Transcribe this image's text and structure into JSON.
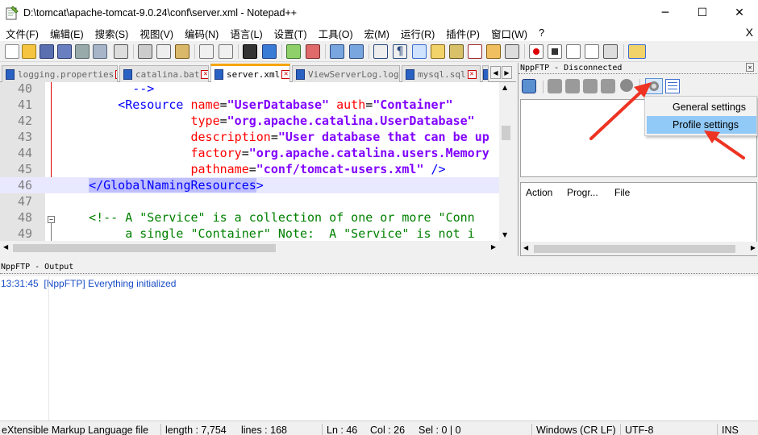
{
  "window": {
    "title": "D:\\tomcat\\apache-tomcat-9.0.24\\conf\\server.xml - Notepad++",
    "minimize": "─",
    "maximize": "☐",
    "close": "✕"
  },
  "menu": {
    "items": [
      "文件(F)",
      "编辑(E)",
      "搜索(S)",
      "视图(V)",
      "编码(N)",
      "语言(L)",
      "设置(T)",
      "工具(O)",
      "宏(M)",
      "运行(R)",
      "插件(P)",
      "窗口(W)",
      "?"
    ],
    "close": "X"
  },
  "tabs": [
    {
      "label": "logging.properties",
      "close": "✕"
    },
    {
      "label": "catalina.bat",
      "close": "✕"
    },
    {
      "label": "server.xml",
      "close": "✕",
      "active": true
    },
    {
      "label": "ViewServerLog.log",
      "close": "✕"
    },
    {
      "label": "mysql.sql",
      "close": "✕"
    }
  ],
  "tab_nav": {
    "left": "◀",
    "right": "▶"
  },
  "editor": {
    "lines": [
      {
        "n": "40",
        "parts": [
          {
            "t": "        -->",
            "c": "tag"
          }
        ]
      },
      {
        "n": "41",
        "parts": [
          {
            "t": "      <Resource ",
            "c": "tag"
          },
          {
            "t": "name",
            "c": "attr"
          },
          {
            "t": "=",
            "c": ""
          },
          {
            "t": "\"UserDatabase\"",
            "c": "val"
          },
          {
            "t": " auth",
            "c": "attr"
          },
          {
            "t": "=",
            "c": ""
          },
          {
            "t": "\"Container\"",
            "c": "val"
          }
        ]
      },
      {
        "n": "42",
        "parts": [
          {
            "t": "                type",
            "c": "attr"
          },
          {
            "t": "=",
            "c": ""
          },
          {
            "t": "\"org.apache.catalina.UserDatabase\"",
            "c": "val"
          }
        ]
      },
      {
        "n": "43",
        "parts": [
          {
            "t": "                description",
            "c": "attr"
          },
          {
            "t": "=",
            "c": ""
          },
          {
            "t": "\"User database that can be up",
            "c": "val"
          }
        ]
      },
      {
        "n": "44",
        "parts": [
          {
            "t": "                factory",
            "c": "attr"
          },
          {
            "t": "=",
            "c": ""
          },
          {
            "t": "\"org.apache.catalina.users.Memory",
            "c": "val"
          }
        ]
      },
      {
        "n": "45",
        "parts": [
          {
            "t": "                pathname",
            "c": "attr"
          },
          {
            "t": "=",
            "c": ""
          },
          {
            "t": "\"conf/tomcat-users.xml\"",
            "c": "val"
          },
          {
            "t": " />",
            "c": "tag"
          }
        ]
      },
      {
        "n": "46",
        "parts": [
          {
            "t": "  ",
            "c": ""
          },
          {
            "t": "</GlobalNamingResources",
            "c": "hlt"
          },
          {
            "t": ">",
            "c": "tag"
          }
        ],
        "hl": true
      },
      {
        "n": "47",
        "parts": []
      },
      {
        "n": "48",
        "parts": [
          {
            "t": "  <!-- A \"Service\" is a collection of one or more \"Conn",
            "c": "cmt"
          }
        ]
      },
      {
        "n": "49",
        "parts": [
          {
            "t": "       a single \"Container\" Note:  A \"Service\" is not i",
            "c": "cmt"
          }
        ]
      }
    ]
  },
  "nppftp": {
    "caption": "NppFTP - Disconnected",
    "close": "✕",
    "columns": [
      "Action",
      "Progr...",
      "File"
    ],
    "menu": {
      "items": [
        {
          "label": "General settings"
        },
        {
          "label": "Profile settings",
          "selected": true
        }
      ]
    }
  },
  "output": {
    "caption": "NppFTP - Output",
    "line": "13:31:45  [NppFTP] Everything initialized"
  },
  "status": {
    "language": "eXtensible Markup Language file",
    "length": "length : 7,754",
    "lines": "lines : 168",
    "ln": "Ln : 46",
    "col": "Col : 26",
    "sel": "Sel : 0 | 0",
    "eol": "Windows (CR LF)",
    "encoding": "UTF-8",
    "mode": "INS"
  },
  "colors": {
    "accent_arrow": "#ee3322",
    "selection": "#91c9f7",
    "tab_active_border": "#f6a500"
  }
}
